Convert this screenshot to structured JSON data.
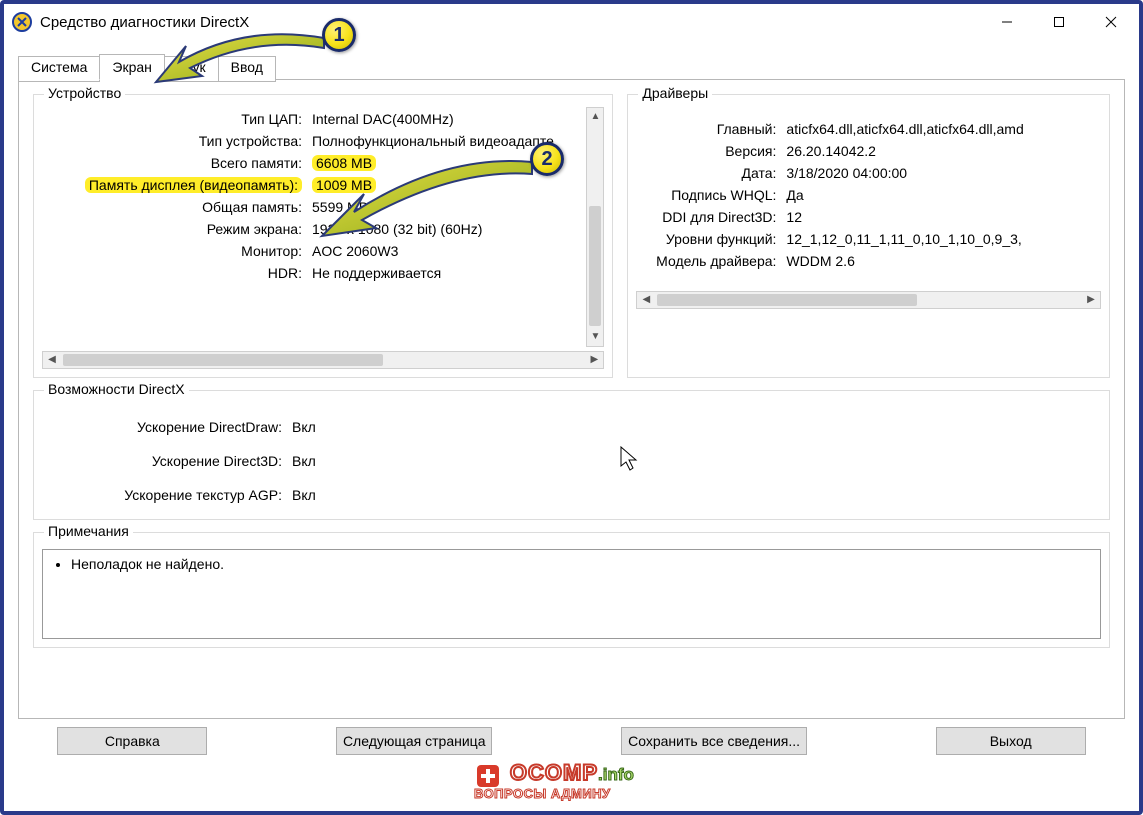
{
  "titlebar": {
    "title": "Средство диагностики DirectX"
  },
  "tabs": {
    "t0": "Система",
    "t1": "Экран",
    "t2": "Звук",
    "t3": "Ввод"
  },
  "device": {
    "legend": "Устройство",
    "rows": {
      "r0l": "Тип ЦАП:",
      "r0v": "Internal DAC(400MHz)",
      "r1l": "Тип устройства:",
      "r1v": "Полнофункциональный видеоадапте",
      "r2l": "Всего памяти:",
      "r2v": "6608 MB",
      "r3l": "Память дисплея (видеопамять):",
      "r3v": "1009 MB",
      "r4l": "Общая память:",
      "r4v": "5599 MB",
      "r5l": "Режим экрана:",
      "r5v": "1920 x 1080 (32 bit) (60Hz)",
      "r6l": "Монитор:",
      "r6v": "AOC 2060W3",
      "r7l": "HDR:",
      "r7v": "Не поддерживается"
    }
  },
  "drivers": {
    "legend": "Драйверы",
    "rows": {
      "r0l": "Главный:",
      "r0v": "aticfx64.dll,aticfx64.dll,aticfx64.dll,amd",
      "r1l": "Версия:",
      "r1v": "26.20.14042.2",
      "r2l": "Дата:",
      "r2v": "3/18/2020 04:00:00",
      "r3l": "Подпись WHQL:",
      "r3v": "Да",
      "r4l": "DDI для Direct3D:",
      "r4v": "12",
      "r5l": "Уровни функций:",
      "r5v": "12_1,12_0,11_1,11_0,10_1,10_0,9_3,",
      "r6l": "Модель драйвера:",
      "r6v": "WDDM 2.6"
    }
  },
  "dxcap": {
    "legend": "Возможности DirectX",
    "r0l": "Ускорение DirectDraw:",
    "r0v": "Вкл",
    "r1l": "Ускорение Direct3D:",
    "r1v": "Вкл",
    "r2l": "Ускорение текстур AGP:",
    "r2v": "Вкл"
  },
  "notes": {
    "legend": "Примечания",
    "item0": "Неполадок не найдено."
  },
  "buttons": {
    "help": "Справка",
    "next": "Следующая страница",
    "save": "Сохранить все сведения...",
    "exit": "Выход"
  },
  "markers": {
    "m1": "1",
    "m2": "2"
  },
  "watermark": {
    "line1a": "OCOMP",
    "line1b": ".info",
    "line2": "ВОПРОСЫ АДМИНУ"
  }
}
